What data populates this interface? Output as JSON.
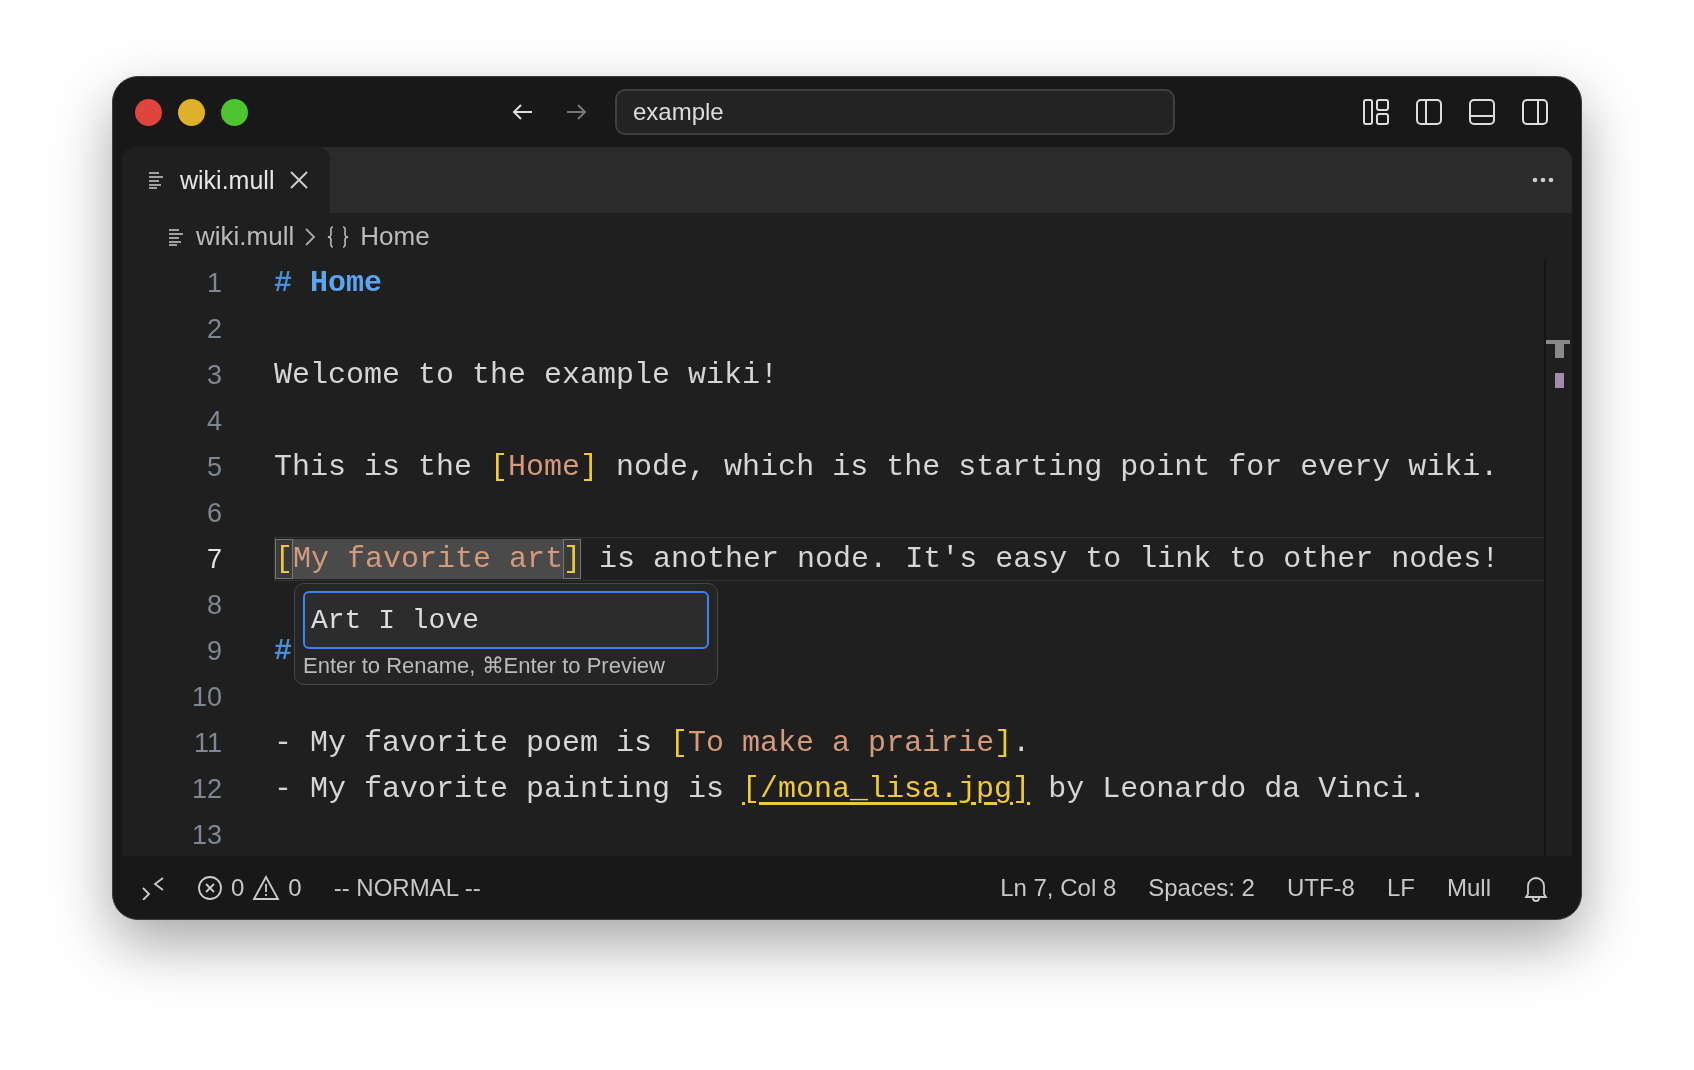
{
  "titlebar": {
    "navigation": [
      {
        "kind": "back",
        "disabled": false
      },
      {
        "kind": "forward",
        "disabled": true
      }
    ],
    "search": {
      "value": "example"
    }
  },
  "tabs": [
    {
      "label": "wiki.mull",
      "selected": true
    }
  ],
  "breadcrumb": [
    {
      "kind": "file",
      "label": "wiki.mull"
    },
    {
      "kind": "symbol",
      "label": "Home"
    }
  ],
  "editor": {
    "lines": [
      {
        "number": "1",
        "current": false,
        "segments": [
          {
            "kind": "heading-mark",
            "text": "# "
          },
          {
            "kind": "heading",
            "text": "Home"
          }
        ]
      },
      {
        "number": "2",
        "current": false
      },
      {
        "number": "3",
        "current": false,
        "segments": [
          {
            "kind": "plain",
            "text": "Welcome to the example wiki!"
          }
        ]
      },
      {
        "number": "4",
        "current": false
      },
      {
        "number": "5",
        "current": false,
        "segments": [
          {
            "kind": "plain",
            "text": "This is the "
          },
          {
            "kind": "bracket",
            "text": "["
          },
          {
            "kind": "link",
            "text": "Home"
          },
          {
            "kind": "bracket",
            "text": "]"
          },
          {
            "kind": "plain",
            "text": " node, which is the starting point for every wiki."
          }
        ]
      },
      {
        "number": "6",
        "current": false
      },
      {
        "number": "7",
        "current": true,
        "segments": [
          {
            "kind": "bracket",
            "text": "[",
            "highlighted": true
          },
          {
            "kind": "link",
            "text": "My favorite art",
            "highlighted": true
          },
          {
            "kind": "bracket",
            "text": "]",
            "highlighted": true
          },
          {
            "kind": "plain",
            "text": " is another node. It's easy to link to other nodes!"
          }
        ]
      },
      {
        "number": "8",
        "current": false
      },
      {
        "number": "9",
        "current": false,
        "segments": [
          {
            "kind": "heading-mark",
            "text": "#"
          }
        ]
      },
      {
        "number": "10",
        "current": false
      },
      {
        "number": "11",
        "current": false,
        "segments": [
          {
            "kind": "plain",
            "text": "- My favorite poem is "
          },
          {
            "kind": "bracket",
            "text": "["
          },
          {
            "kind": "link",
            "text": "To make a prairie"
          },
          {
            "kind": "bracket",
            "text": "]"
          },
          {
            "kind": "plain",
            "text": "."
          }
        ]
      },
      {
        "number": "12",
        "current": false,
        "segments": [
          {
            "kind": "plain",
            "text": "- My favorite painting is "
          },
          {
            "kind": "image-link",
            "text": "[/mona_lisa.jpg]"
          },
          {
            "kind": "plain",
            "text": " by Leonardo da Vinci."
          }
        ]
      },
      {
        "number": "13",
        "current": false
      }
    ]
  },
  "rename_popup": {
    "value": "Art I love",
    "hint": "Enter to Rename, ⌘Enter to Preview"
  },
  "status_bar": {
    "errors": "0",
    "warnings": "0",
    "mode": "-- NORMAL --",
    "items": [
      "Ln 7, Col 8",
      "Spaces: 2",
      "UTF-8",
      "LF",
      "Mull"
    ]
  }
}
